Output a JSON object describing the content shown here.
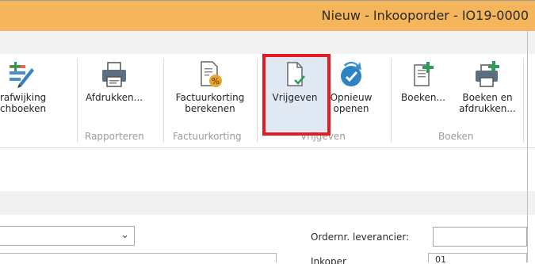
{
  "window": {
    "title": "Nieuw - Inkooporder - IO19-0000"
  },
  "ribbon": {
    "buttons": {
      "bijrafwijking": "rafwijking\nchboeken",
      "afdrukken": "Afdrukken...",
      "factuurkorting": "Factuurkorting\nberekenen",
      "vrijgeven": "Vrijgeven",
      "opnieuw_openen": "Opnieuw\nopenen",
      "boeken": "Boeken...",
      "boeken_afdrukken": "Boeken en\nafdrukken..."
    },
    "groups": {
      "rapporteren": "Rapporteren",
      "factuurkorting": "Factuurkorting",
      "vrijgeven": "Vrijgeven",
      "boeken": "Boeken"
    }
  },
  "form": {
    "ordernr_label": "Ordernr. leverancier:",
    "partial_label": "Inkoper",
    "partial_value": "01"
  },
  "colors": {
    "title_bar": "#f4b55b",
    "highlight_border": "#e31b23",
    "selected_bg": "#dfe8f3"
  },
  "icons": [
    "edit-pencil-icon",
    "printer-icon",
    "document-percent-icon",
    "document-check-icon",
    "reopen-icon",
    "post-document-icon",
    "post-print-icon",
    "chevron-down-icon"
  ]
}
